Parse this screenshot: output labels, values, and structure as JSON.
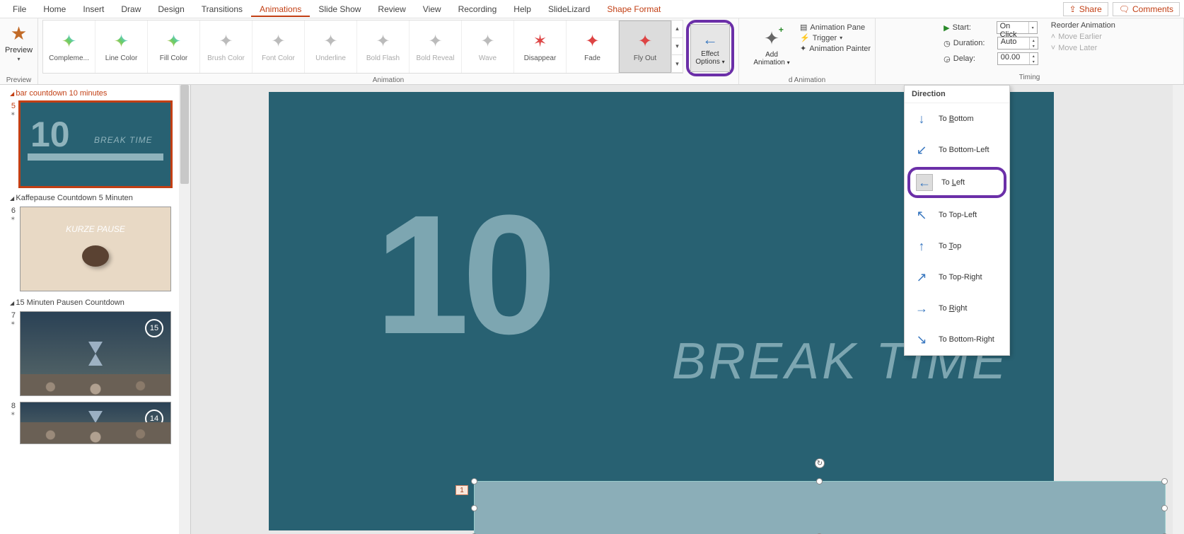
{
  "menubar": {
    "items": [
      "File",
      "Home",
      "Insert",
      "Draw",
      "Design",
      "Transitions",
      "Animations",
      "Slide Show",
      "Review",
      "View",
      "Recording",
      "Help",
      "SlideLizard",
      "Shape Format"
    ],
    "active": "Animations",
    "share": "Share",
    "comments": "Comments"
  },
  "ribbon": {
    "preview": {
      "label": "Preview",
      "group": "Preview"
    },
    "animation_group": "Animation",
    "gallery": [
      {
        "label": "Compleme...",
        "variant": "rainbow"
      },
      {
        "label": "Line Color",
        "variant": "rainbow"
      },
      {
        "label": "Fill Color",
        "variant": "rainbow"
      },
      {
        "label": "Brush Color",
        "variant": "grey"
      },
      {
        "label": "Font Color",
        "variant": "grey"
      },
      {
        "label": "Underline",
        "variant": "grey"
      },
      {
        "label": "Bold Flash",
        "variant": "grey"
      },
      {
        "label": "Bold Reveal",
        "variant": "grey"
      },
      {
        "label": "Wave",
        "variant": "grey"
      },
      {
        "label": "Disappear",
        "variant": "red"
      },
      {
        "label": "Fade",
        "variant": "red"
      },
      {
        "label": "Fly Out",
        "variant": "red",
        "selected": true
      }
    ],
    "effect_options": {
      "line1": "Effect",
      "line2": "Options"
    },
    "add_animation": {
      "line1": "Add",
      "line2": "Animation"
    },
    "adv_group": "d Animation",
    "adv": {
      "pane": "Animation Pane",
      "trigger": "Trigger",
      "painter": "Animation Painter"
    },
    "timing_group": "Timing",
    "timing": {
      "start_label": "Start:",
      "start_value": "On Click",
      "duration_label": "Duration:",
      "duration_value": "Auto",
      "delay_label": "Delay:",
      "delay_value": "00.00",
      "reorder": "Reorder Animation",
      "earlier": "Move Earlier",
      "later": "Move Later"
    }
  },
  "sections": [
    {
      "title": "bar countdown 10 minutes",
      "active": true,
      "slides": [
        {
          "num": "5",
          "type": "bar10",
          "selected": true
        }
      ]
    },
    {
      "title": "Kaffepause Countdown 5 Minuten",
      "slides": [
        {
          "num": "6",
          "type": "coffee",
          "text": "KURZE PAUSE"
        }
      ]
    },
    {
      "title": "15 Minuten Pausen Countdown",
      "slides": [
        {
          "num": "7",
          "type": "hourglass",
          "badge": "15"
        },
        {
          "num": "8",
          "type": "hourglass",
          "badge": "14"
        }
      ]
    }
  ],
  "slide": {
    "big": "10",
    "breaktime": "BREAK TIME",
    "anim_tag": "1"
  },
  "direction_menu": {
    "header": "Direction",
    "items": [
      {
        "label": "To Bottom",
        "ul": "B",
        "arrow": "down"
      },
      {
        "label": "To Bottom-Left",
        "ul": "",
        "arrow": "down-left"
      },
      {
        "label": "To Left",
        "ul": "L",
        "arrow": "left",
        "selected": true
      },
      {
        "label": "To Top-Left",
        "ul": "",
        "arrow": "up-left"
      },
      {
        "label": "To Top",
        "ul": "T",
        "arrow": "up"
      },
      {
        "label": "To Top-Right",
        "ul": "",
        "arrow": "up-right"
      },
      {
        "label": "To Right",
        "ul": "R",
        "arrow": "right"
      },
      {
        "label": "To Bottom-Right",
        "ul": "",
        "arrow": "down-right"
      }
    ]
  }
}
